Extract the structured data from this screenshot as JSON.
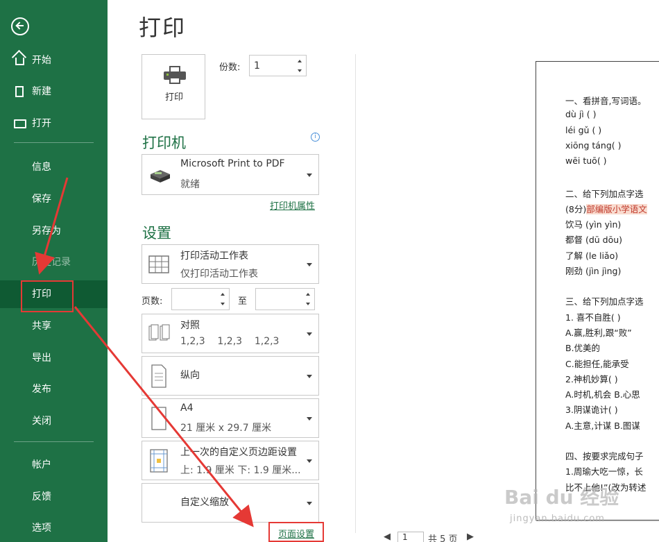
{
  "sidebar": {
    "items": [
      {
        "label": "开始",
        "icon": "home-icon"
      },
      {
        "label": "新建",
        "icon": "new-document-icon"
      },
      {
        "label": "打开",
        "icon": "open-folder-icon"
      },
      {
        "label": "信息"
      },
      {
        "label": "保存"
      },
      {
        "label": "另存为"
      },
      {
        "label": "历史记录"
      },
      {
        "label": "打印"
      },
      {
        "label": "共享"
      },
      {
        "label": "导出"
      },
      {
        "label": "发布"
      },
      {
        "label": "关闭"
      },
      {
        "label": "帐户"
      },
      {
        "label": "反馈"
      },
      {
        "label": "选项"
      }
    ],
    "selected": "打印",
    "background": "#1e7145"
  },
  "page": {
    "title": "打印"
  },
  "print": {
    "button_label": "打印",
    "copies_label": "份数:",
    "copies_value": "1"
  },
  "printer": {
    "section_title": "打印机",
    "name": "Microsoft Print to PDF",
    "status": "就绪",
    "properties_link": "打印机属性"
  },
  "settings": {
    "section_title": "设置",
    "scope": {
      "line1": "打印活动工作表",
      "line2": "仅打印活动工作表"
    },
    "pages_label": "页数:",
    "to_label": "至",
    "collate": {
      "line1": "对照",
      "line2": "1,2,3    1,2,3    1,2,3"
    },
    "orientation": {
      "line1": "纵向"
    },
    "paper": {
      "line1": "A4",
      "line2": "21 厘米 x 29.7 厘米"
    },
    "margins": {
      "line1": "上一次的自定义页边距设置",
      "line2": "上: 1.9 厘米 下: 1.9 厘米..."
    },
    "scaling": {
      "line1": "自定义缩放"
    },
    "page_setup_link": "页面设置"
  },
  "preview": {
    "lines": [
      "一、看拼音,写词语。",
      "dù jì (        )",
      "léi gǔ (        )",
      "xiōng táng(        )",
      "wēi tuō(        )",
      "",
      "二、给下列加点字选",
      "(8分)",
      "饮马 (yìn  yìn)",
      "都督 (dū   dōu)",
      "了解 (le  liǎo)",
      "刚劲 (jìn  jìng)",
      "",
      "三、给下列加点字选",
      "1. 喜不自胜(     )",
      "A.赢,胜利,跟“败”",
      "B.优美的",
      "C.能担任,能承受",
      "2.神机妙算(     )",
      "A.时机,机会   B.心思",
      "3.阴谋诡计(     )",
      "A.主意,计谋   B.图谋",
      "",
      "四、按要求完成句子",
      "1.周瑜大吃一惊，长",
      "比不上他!”(改为转述"
    ],
    "highlight": "部编版小学语文",
    "page_nav_value": "1",
    "page_nav_total": "共 5 页"
  },
  "watermark": {
    "text": "Bai du 经验",
    "sub": "jingyan.baidu.com"
  },
  "annotation_color": "#e53935"
}
